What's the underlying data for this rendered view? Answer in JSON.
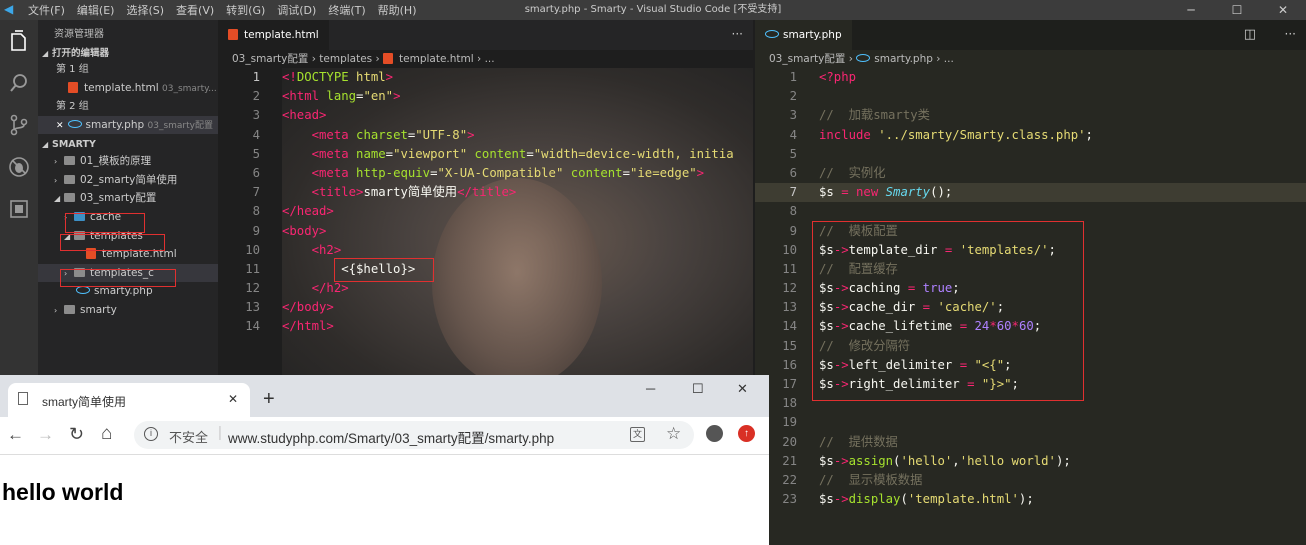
{
  "titlebar": {
    "menu": [
      "文件(F)",
      "编辑(E)",
      "选择(S)",
      "查看(V)",
      "转到(G)",
      "调试(D)",
      "终端(T)",
      "帮助(H)"
    ],
    "title": "smarty.php - Smarty - Visual Studio Code [不受支持]",
    "min": "─",
    "max": "☐",
    "close": "✕"
  },
  "sidebar": {
    "header": "资源管理器",
    "open_editors": "打开的编辑器",
    "group1": "第 1 组",
    "group1_file": "template.html",
    "group1_path": "03_smarty...",
    "group2": "第 2 组",
    "group2_file": "smarty.php",
    "group2_path": "03_smarty配置",
    "group2_close": "✕",
    "project": "SMARTY",
    "tree": [
      {
        "label": "01_模板的原理"
      },
      {
        "label": "02_smarty简单使用"
      },
      {
        "label": "03_smarty配置"
      },
      {
        "label": "cache"
      },
      {
        "label": "templates"
      },
      {
        "label": "template.html"
      },
      {
        "label": "templates_c"
      },
      {
        "label": "smarty.php"
      },
      {
        "label": "smarty"
      }
    ]
  },
  "editor1": {
    "tab": "template.html",
    "crumbs": [
      "03_smarty配置",
      "templates",
      "template.html",
      "..."
    ],
    "more": "···",
    "lines": [
      {
        "n": "1",
        "parts": [
          [
            "p",
            "<!"
          ],
          [
            "g",
            "DOCTYPE "
          ],
          [
            "y",
            "html"
          ],
          [
            "p",
            ">"
          ]
        ]
      },
      {
        "n": "2",
        "parts": [
          [
            "p",
            "<html "
          ],
          [
            "a",
            "lang"
          ],
          [
            "w",
            "="
          ],
          [
            "y",
            "\"en\""
          ],
          [
            "p",
            ">"
          ]
        ]
      },
      {
        "n": "3",
        "parts": [
          [
            "p",
            "<head>"
          ]
        ]
      },
      {
        "n": "4",
        "parts": [
          [
            "w",
            "    "
          ],
          [
            "p",
            "<meta "
          ],
          [
            "a",
            "charset"
          ],
          [
            "w",
            "="
          ],
          [
            "y",
            "\"UTF-8\""
          ],
          [
            "p",
            ">"
          ]
        ]
      },
      {
        "n": "5",
        "parts": [
          [
            "w",
            "    "
          ],
          [
            "p",
            "<meta "
          ],
          [
            "a",
            "name"
          ],
          [
            "w",
            "="
          ],
          [
            "y",
            "\"viewport\" "
          ],
          [
            "a",
            "content"
          ],
          [
            "w",
            "="
          ],
          [
            "y",
            "\"width=device-width, initia"
          ]
        ]
      },
      {
        "n": "6",
        "parts": [
          [
            "w",
            "    "
          ],
          [
            "p",
            "<meta "
          ],
          [
            "a",
            "http-equiv"
          ],
          [
            "w",
            "="
          ],
          [
            "y",
            "\"X-UA-Compatible\" "
          ],
          [
            "a",
            "content"
          ],
          [
            "w",
            "="
          ],
          [
            "y",
            "\"ie=edge\""
          ],
          [
            "p",
            ">"
          ]
        ]
      },
      {
        "n": "7",
        "parts": [
          [
            "w",
            "    "
          ],
          [
            "p",
            "<title>"
          ],
          [
            "w",
            "smarty简单使用"
          ],
          [
            "p",
            "</title>"
          ]
        ]
      },
      {
        "n": "8",
        "parts": [
          [
            "p",
            "</head>"
          ]
        ]
      },
      {
        "n": "9",
        "parts": [
          [
            "p",
            "<body>"
          ]
        ]
      },
      {
        "n": "10",
        "parts": [
          [
            "w",
            "    "
          ],
          [
            "p",
            "<h2>"
          ]
        ]
      },
      {
        "n": "11",
        "parts": [
          [
            "w",
            "        <{$hello}>"
          ]
        ]
      },
      {
        "n": "12",
        "parts": [
          [
            "w",
            "    "
          ],
          [
            "p",
            "</h2>"
          ]
        ]
      },
      {
        "n": "13",
        "parts": [
          [
            "p",
            "</body>"
          ]
        ]
      },
      {
        "n": "14",
        "parts": [
          [
            "p",
            "</html>"
          ]
        ]
      }
    ]
  },
  "editor2": {
    "tab": "smarty.php",
    "crumbs": [
      "03_smarty配置",
      "smarty.php",
      "..."
    ],
    "split_icon": "◫",
    "more": "···",
    "lines": [
      {
        "n": "1",
        "parts": [
          [
            "p",
            "<?php"
          ]
        ]
      },
      {
        "n": "2",
        "parts": []
      },
      {
        "n": "3",
        "parts": [
          [
            "c",
            "//  加载smarty类"
          ]
        ]
      },
      {
        "n": "4",
        "parts": [
          [
            "p",
            "include "
          ],
          [
            "y",
            "'../smarty/Smarty.class.php'"
          ],
          [
            "w",
            ";"
          ]
        ]
      },
      {
        "n": "5",
        "parts": []
      },
      {
        "n": "6",
        "parts": [
          [
            "c",
            "//  实例化"
          ]
        ]
      },
      {
        "n": "7",
        "parts": [
          [
            "w",
            "$s "
          ],
          [
            "p",
            "= new "
          ],
          [
            "b",
            "Smarty"
          ],
          [
            "w",
            "();"
          ]
        ]
      },
      {
        "n": "8",
        "parts": []
      },
      {
        "n": "9",
        "parts": [
          [
            "c",
            "//  模板配置"
          ]
        ]
      },
      {
        "n": "10",
        "parts": [
          [
            "w",
            "$s"
          ],
          [
            "p",
            "->"
          ],
          [
            "w",
            "template_dir "
          ],
          [
            "p",
            "= "
          ],
          [
            "y",
            "'templates/'"
          ],
          [
            "w",
            ";"
          ]
        ]
      },
      {
        "n": "11",
        "parts": [
          [
            "c",
            "//  配置缓存"
          ]
        ]
      },
      {
        "n": "12",
        "parts": [
          [
            "w",
            "$s"
          ],
          [
            "p",
            "->"
          ],
          [
            "w",
            "caching "
          ],
          [
            "p",
            "= "
          ],
          [
            "v",
            "true"
          ],
          [
            "w",
            ";"
          ]
        ]
      },
      {
        "n": "13",
        "parts": [
          [
            "w",
            "$s"
          ],
          [
            "p",
            "->"
          ],
          [
            "w",
            "cache_dir "
          ],
          [
            "p",
            "= "
          ],
          [
            "y",
            "'cache/'"
          ],
          [
            "w",
            ";"
          ]
        ]
      },
      {
        "n": "14",
        "parts": [
          [
            "w",
            "$s"
          ],
          [
            "p",
            "->"
          ],
          [
            "w",
            "cache_lifetime "
          ],
          [
            "p",
            "= "
          ],
          [
            "v",
            "24"
          ],
          [
            "p",
            "*"
          ],
          [
            "v",
            "60"
          ],
          [
            "p",
            "*"
          ],
          [
            "v",
            "60"
          ],
          [
            "w",
            ";"
          ]
        ]
      },
      {
        "n": "15",
        "parts": [
          [
            "c",
            "//  修改分隔符"
          ]
        ]
      },
      {
        "n": "16",
        "parts": [
          [
            "w",
            "$s"
          ],
          [
            "p",
            "->"
          ],
          [
            "w",
            "left_delimiter "
          ],
          [
            "p",
            "= "
          ],
          [
            "y",
            "\"<{\""
          ],
          [
            "w",
            ";"
          ]
        ]
      },
      {
        "n": "17",
        "parts": [
          [
            "w",
            "$s"
          ],
          [
            "p",
            "->"
          ],
          [
            "w",
            "right_delimiter "
          ],
          [
            "p",
            "= "
          ],
          [
            "y",
            "\"}>\""
          ],
          [
            "w",
            ";"
          ]
        ]
      },
      {
        "n": "18",
        "parts": []
      },
      {
        "n": "19",
        "parts": []
      },
      {
        "n": "20",
        "parts": [
          [
            "c",
            "//  提供数据"
          ]
        ]
      },
      {
        "n": "21",
        "parts": [
          [
            "w",
            "$s"
          ],
          [
            "p",
            "->"
          ],
          [
            "g",
            "assign"
          ],
          [
            "w",
            "("
          ],
          [
            "y",
            "'hello'"
          ],
          [
            "w",
            ","
          ],
          [
            "y",
            "'hello world'"
          ],
          [
            "w",
            ");"
          ]
        ]
      },
      {
        "n": "22",
        "parts": [
          [
            "c",
            "//  显示模板数据"
          ]
        ]
      },
      {
        "n": "23",
        "parts": [
          [
            "w",
            "$s"
          ],
          [
            "p",
            "->"
          ],
          [
            "g",
            "display"
          ],
          [
            "w",
            "("
          ],
          [
            "y",
            "'template.html'"
          ],
          [
            "w",
            ");"
          ]
        ]
      }
    ]
  },
  "browser": {
    "tab_title": "smarty简单使用",
    "tab_close": "✕",
    "new_tab": "+",
    "min": "─",
    "max": "☐",
    "close": "✕",
    "back": "←",
    "forward": "→",
    "reload": "↻",
    "home": "⌂",
    "security": "不安全",
    "url": "www.studyphp.com/Smarty/03_smarty配置/smarty.php",
    "star": "☆",
    "content_heading": "hello world"
  }
}
